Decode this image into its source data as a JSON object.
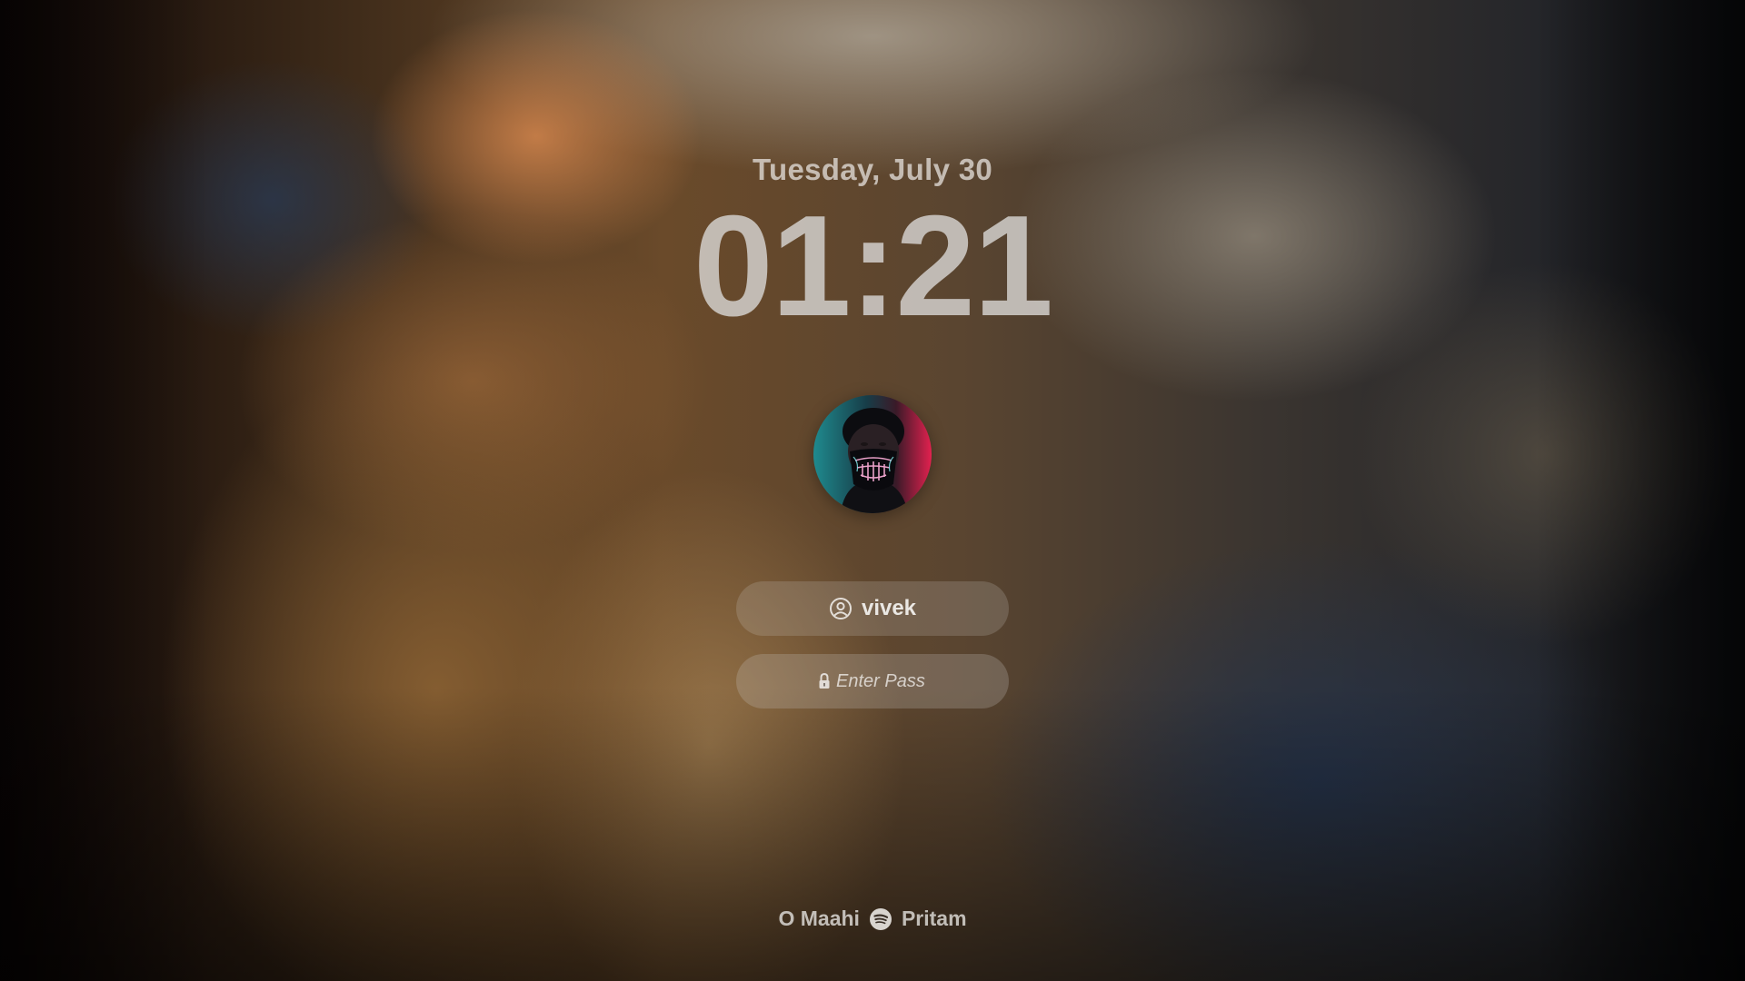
{
  "lock_screen": {
    "date": "Tuesday, July 30",
    "time": "01:21"
  },
  "user": {
    "name": "vivek",
    "icon": "user-circle-icon",
    "avatar": "profile-avatar"
  },
  "password": {
    "placeholder": "Enter Pass",
    "value": "",
    "icon": "lock-icon"
  },
  "now_playing": {
    "track": "O Maahi",
    "artist": "Pritam",
    "icon": "spotify-icon"
  },
  "colors": {
    "text": "#e6e2dd",
    "pill_background": "rgba(200,195,190,0.22)",
    "spotify_icon_bg": "#d8d4cf"
  }
}
